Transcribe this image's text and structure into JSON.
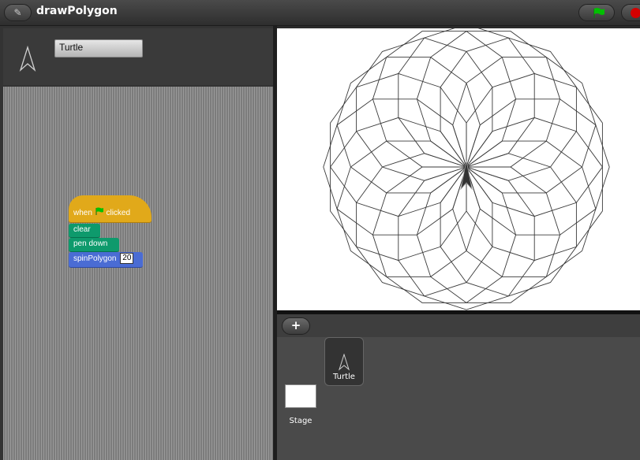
{
  "window": {
    "title": "drawPolygon",
    "edit_icon": "pencil-icon",
    "go_icon": "green-flag-icon",
    "stop_icon": "red-stop-icon"
  },
  "sprite": {
    "name": "Turtle",
    "icon": "turtle-arrow-icon"
  },
  "script": {
    "hat_prefix": "when",
    "hat_suffix": "clicked",
    "blocks": [
      {
        "label": "clear",
        "category": "pen"
      },
      {
        "label": "pen down",
        "category": "pen"
      },
      {
        "label": "spinPolygon",
        "category": "custom",
        "arg": "20"
      }
    ]
  },
  "stage": {
    "drawing": "polygon-rosette",
    "polygons": 20
  },
  "corral": {
    "add_icon": "plus-icon",
    "add_label": "+",
    "sprites": [
      {
        "name": "Turtle"
      }
    ],
    "stage_label": "Stage"
  },
  "colors": {
    "event": "#e1a91a",
    "pen": "#0e9a6c",
    "custom": "#4a6cd4",
    "go": "#00c000",
    "stop": "#d40000"
  }
}
